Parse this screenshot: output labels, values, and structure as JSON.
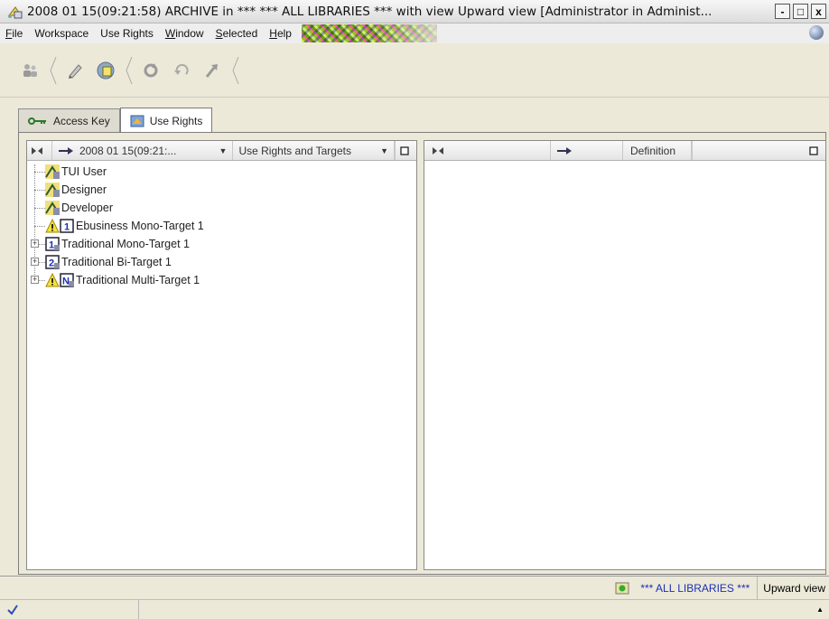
{
  "window": {
    "title": "2008 01 15(09:21:58) ARCHIVE in ***   *** ALL LIBRARIES *** with view Upward view [Administrator in Administ...",
    "minimize": "-",
    "maximize": "□",
    "close": "x"
  },
  "menu": [
    {
      "label": "File",
      "underline": "F",
      "rest": "ile"
    },
    {
      "label": "Workspace",
      "underline": "",
      "rest": "Workspace"
    },
    {
      "label": "Use Rights",
      "underline": "",
      "rest": "Use Rights"
    },
    {
      "label": "Window",
      "underline": "W",
      "rest": "indow"
    },
    {
      "label": "Selected",
      "underline": "S",
      "rest": "elected"
    },
    {
      "label": "Help",
      "underline": "H",
      "rest": "elp"
    }
  ],
  "toolbar": {
    "icons": [
      "users-icon",
      "pencil-icon",
      "archive-icon",
      "refresh-icon",
      "undo-icon",
      "redo-icon"
    ]
  },
  "tabs": [
    {
      "label": "Access Key",
      "icon": "key-icon",
      "active": false
    },
    {
      "label": "Use Rights",
      "icon": "use-rights-icon",
      "active": true
    }
  ],
  "left_pane": {
    "header": {
      "date_selector": "2008 01 15(09:21:...",
      "view_selector": "Use Rights and Targets"
    },
    "tree": [
      {
        "label": "TUI User",
        "icon": "user-profile-icon",
        "expandable": false,
        "warning": false
      },
      {
        "label": "Designer",
        "icon": "user-profile-icon",
        "expandable": false,
        "warning": false
      },
      {
        "label": "Developer",
        "icon": "user-profile-icon",
        "expandable": false,
        "warning": false
      },
      {
        "label": "Ebusiness Mono-Target 1",
        "icon": "target-1-icon",
        "expandable": false,
        "warning": true
      },
      {
        "label": "Traditional Mono-Target 1",
        "icon": "target-1-icon",
        "expandable": true,
        "warning": false
      },
      {
        "label": "Traditional Bi-Target 1",
        "icon": "target-2-icon",
        "expandable": true,
        "warning": false
      },
      {
        "label": "Traditional Multi-Target 1",
        "icon": "target-n-icon",
        "expandable": true,
        "warning": true
      }
    ]
  },
  "right_pane": {
    "header": {
      "definition": "Definition"
    }
  },
  "status": {
    "library": "*** ALL LIBRARIES ***",
    "view": "Upward view"
  },
  "colors": {
    "library_text": "#1d2fb8",
    "background": "#ece9d8"
  }
}
